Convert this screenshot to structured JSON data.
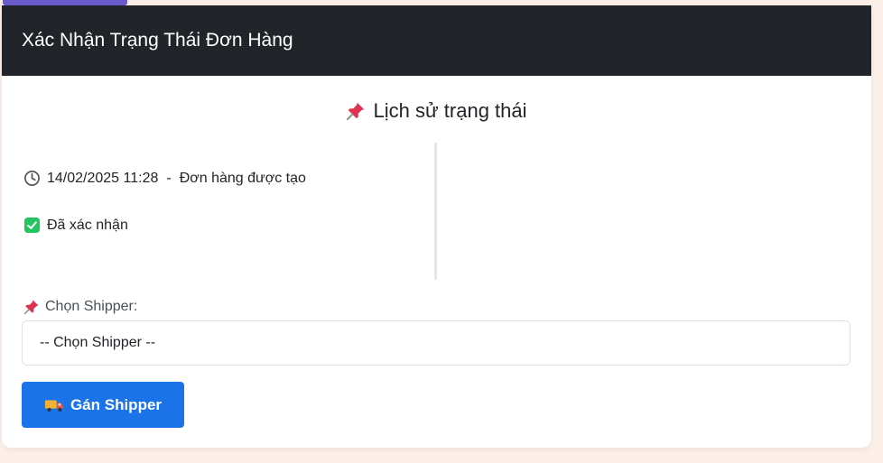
{
  "header": {
    "title": "Xác Nhận Trạng Thái Đơn Hàng"
  },
  "history": {
    "title": "Lịch sử trạng thái",
    "title_icon": "pushpin-icon",
    "entries": [
      {
        "icon": "clock-icon",
        "datetime": "14/02/2025 11:28",
        "separator": "-",
        "text": "Đơn hàng được tạo"
      },
      {
        "icon": "check-mark-icon",
        "text": "Đã xác nhận"
      }
    ]
  },
  "shipper": {
    "label": "Chọn Shipper:",
    "label_icon": "pushpin-icon",
    "select_value": "-- Chọn Shipper --"
  },
  "assign_button": {
    "label": "Gán Shipper",
    "icon": "truck-icon"
  },
  "colors": {
    "header_bg": "#212529",
    "accent_bar": "#6a5acd",
    "button_bg": "#1a73e8",
    "check_green": "#22c55e",
    "page_bg": "#fbefe7"
  }
}
